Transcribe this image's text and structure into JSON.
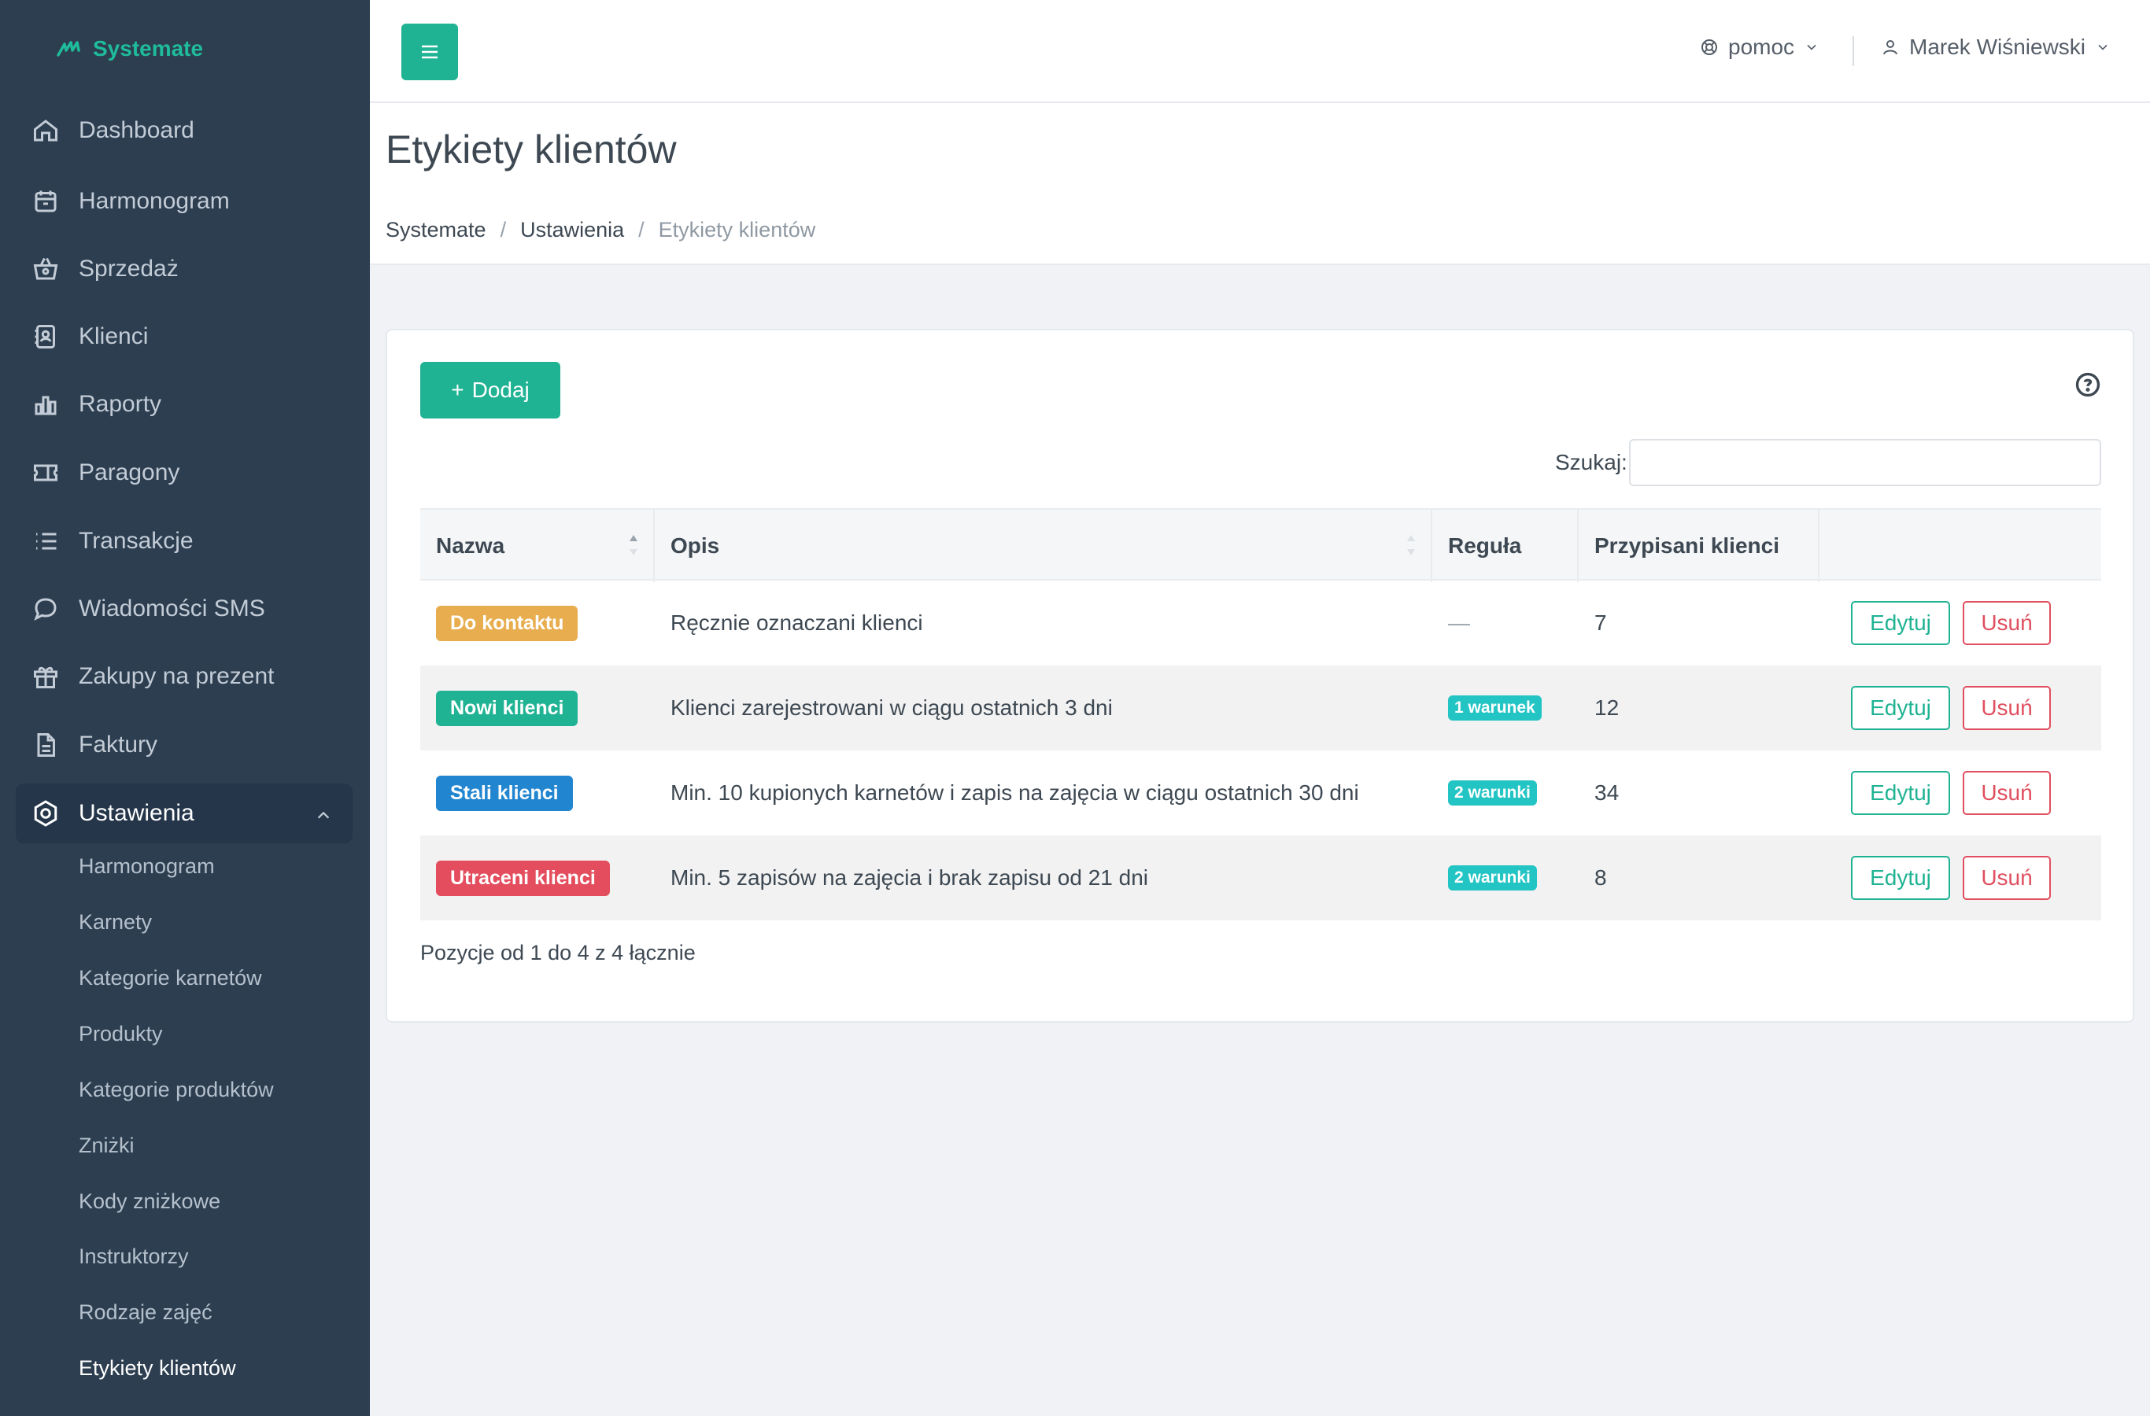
{
  "brand": {
    "name": "Systemate"
  },
  "sidebar": {
    "items": [
      {
        "label": "Dashboard",
        "icon": "home-icon"
      },
      {
        "label": "Harmonogram",
        "icon": "calendar-icon"
      },
      {
        "label": "Sprzedaż",
        "icon": "basket-icon"
      },
      {
        "label": "Klienci",
        "icon": "contacts-icon"
      },
      {
        "label": "Raporty",
        "icon": "bar-chart-icon"
      },
      {
        "label": "Paragony",
        "icon": "ticket-icon"
      },
      {
        "label": "Transakcje",
        "icon": "list-icon"
      },
      {
        "label": "Wiadomości SMS",
        "icon": "chat-icon"
      },
      {
        "label": "Zakupy na prezent",
        "icon": "gift-icon"
      },
      {
        "label": "Faktury",
        "icon": "document-icon"
      },
      {
        "label": "Ustawienia",
        "icon": "settings-icon"
      }
    ],
    "sub_items": [
      "Harmonogram",
      "Karnety",
      "Kategorie karnetów",
      "Produkty",
      "Kategorie produktów",
      "Zniżki",
      "Kody zniżkowe",
      "Instruktorzy",
      "Rodzaje zajęć",
      "Etykiety klientów"
    ]
  },
  "topbar": {
    "help_label": "pomoc",
    "user_name": "Marek Wiśniewski"
  },
  "page": {
    "title": "Etykiety klientów",
    "breadcrumb": [
      "Systemate",
      "Ustawienia",
      "Etykiety klientów"
    ]
  },
  "toolbar": {
    "add_label": "Dodaj",
    "search_label": "Szukaj:",
    "search_value": ""
  },
  "table": {
    "headers": [
      "Nazwa",
      "Opis",
      "Reguła",
      "Przypisani klienci",
      ""
    ],
    "rows": [
      {
        "name": "Do kontaktu",
        "color": "#e8ad4f",
        "description": "Ręcznie oznaczani klienci",
        "rule": "—",
        "clients": "7",
        "edit": "Edytuj",
        "delete": "Usuń"
      },
      {
        "name": "Nowi klienci",
        "color": "#1fb394",
        "description": "Klienci zarejestrowani w ciągu ostatnich 3 dni",
        "rule": "1 warunek",
        "clients": "12",
        "edit": "Edytuj",
        "delete": "Usuń"
      },
      {
        "name": "Stali klienci",
        "color": "#2185d0",
        "description": "Min. 10 kupionych karnetów i zapis na zajęcia w ciągu ostatnich 30 dni",
        "rule": "2 warunki",
        "clients": "34",
        "edit": "Edytuj",
        "delete": "Usuń"
      },
      {
        "name": "Utraceni klienci",
        "color": "#e44d5d",
        "description": "Min. 5 zapisów na zajęcia i brak zapisu od 21 dni",
        "rule": "2 warunki",
        "clients": "8",
        "edit": "Edytuj",
        "delete": "Usuń"
      }
    ],
    "info": "Pozycje od 1 do 4 z 4 łącznie"
  },
  "colors": {
    "accent": "#1fb394",
    "sidebar_bg": "#2c3e50",
    "danger": "#e04f5f",
    "rule_badge": "#23c4c4"
  }
}
